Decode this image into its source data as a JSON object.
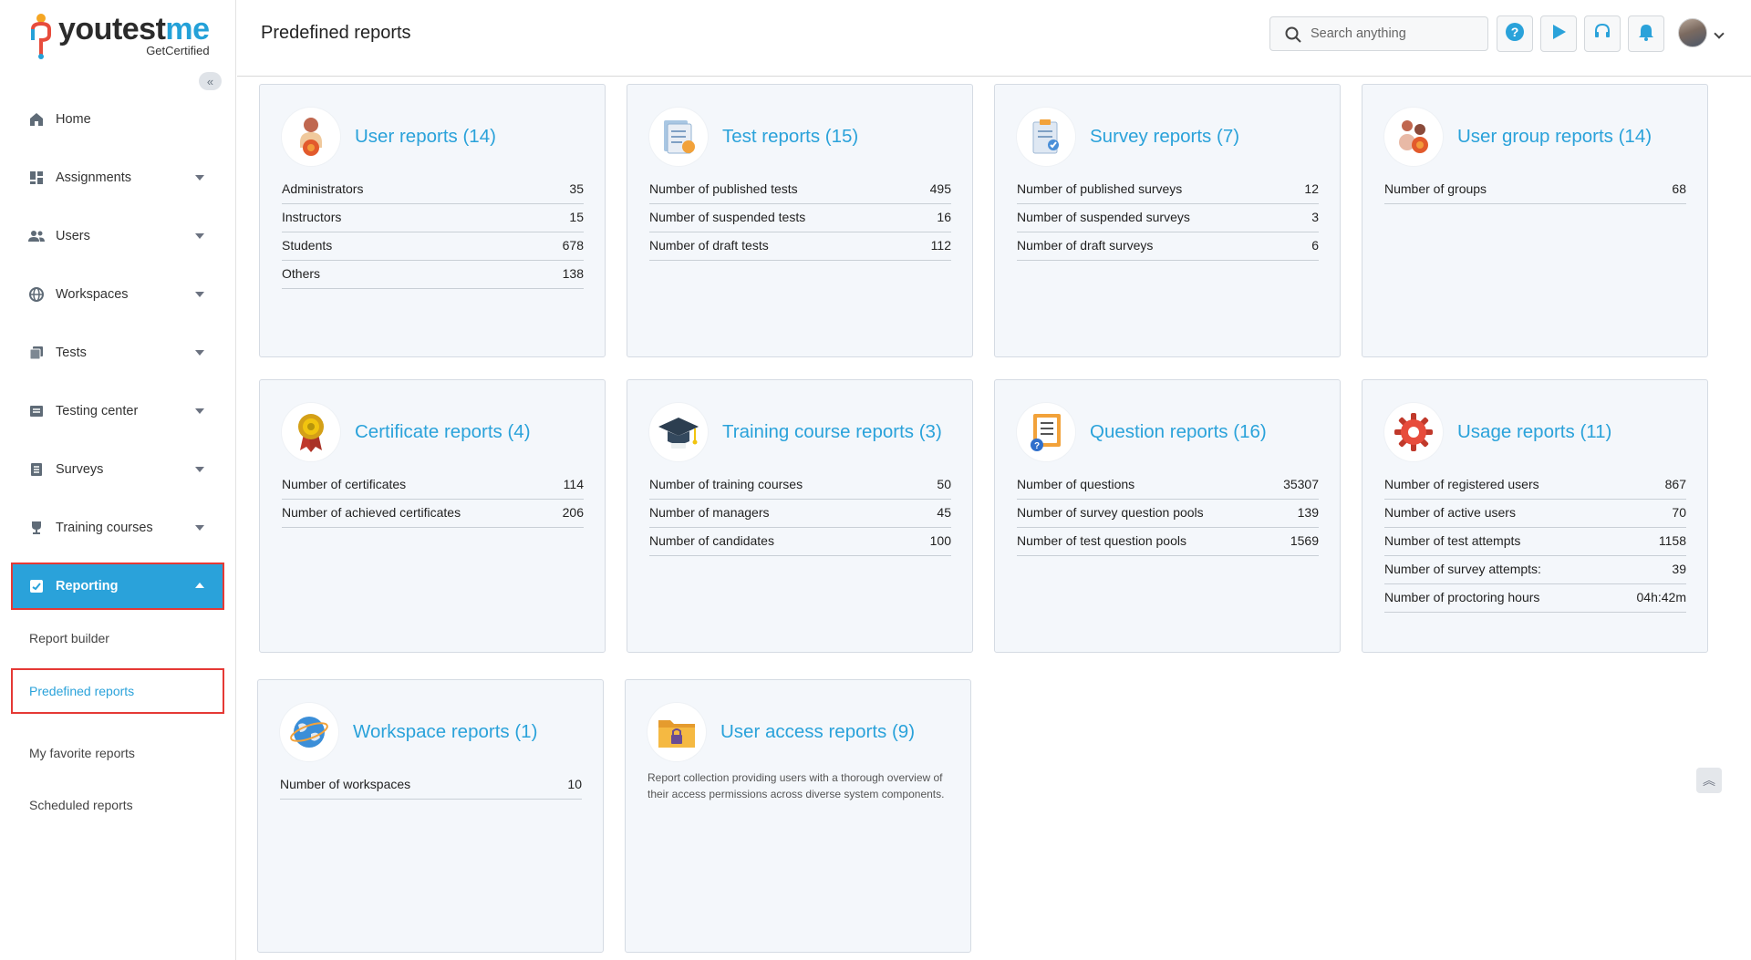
{
  "brand": {
    "name_part1": "youtest",
    "name_part2": "me",
    "tagline": "GetCertified"
  },
  "header": {
    "title": "Predefined reports",
    "search_placeholder": "Search anything"
  },
  "sidebar": {
    "items": [
      {
        "label": "Home",
        "icon": "home-icon"
      },
      {
        "label": "Assignments",
        "icon": "assignments-icon"
      },
      {
        "label": "Users",
        "icon": "users-icon"
      },
      {
        "label": "Workspaces",
        "icon": "globe-icon"
      },
      {
        "label": "Tests",
        "icon": "tests-icon"
      },
      {
        "label": "Testing center",
        "icon": "testing-center-icon"
      },
      {
        "label": "Surveys",
        "icon": "surveys-icon"
      },
      {
        "label": "Training courses",
        "icon": "trophy-icon"
      },
      {
        "label": "Reporting",
        "icon": "reporting-icon"
      }
    ],
    "reporting_sub": [
      {
        "label": "Report builder"
      },
      {
        "label": "Predefined reports"
      },
      {
        "label": "My favorite reports"
      },
      {
        "label": "Scheduled reports"
      }
    ]
  },
  "cards": [
    {
      "title": "User reports (14)",
      "icon": "user-reports-icon",
      "rows": [
        {
          "label": "Administrators",
          "value": "35"
        },
        {
          "label": "Instructors",
          "value": "15"
        },
        {
          "label": "Students",
          "value": "678"
        },
        {
          "label": "Others",
          "value": "138"
        }
      ]
    },
    {
      "title": "Test reports (15)",
      "icon": "test-reports-icon",
      "rows": [
        {
          "label": "Number of published tests",
          "value": "495"
        },
        {
          "label": "Number of suspended tests",
          "value": "16"
        },
        {
          "label": "Number of draft tests",
          "value": "112"
        }
      ]
    },
    {
      "title": "Survey reports (7)",
      "icon": "survey-reports-icon",
      "rows": [
        {
          "label": "Number of published surveys",
          "value": "12"
        },
        {
          "label": "Number of suspended surveys",
          "value": "3"
        },
        {
          "label": "Number of draft surveys",
          "value": "6"
        }
      ]
    },
    {
      "title": "User group reports (14)",
      "icon": "user-group-reports-icon",
      "rows": [
        {
          "label": "Number of groups",
          "value": "68"
        }
      ]
    },
    {
      "title": "Certificate reports (4)",
      "icon": "certificate-reports-icon",
      "rows": [
        {
          "label": "Number of certificates",
          "value": "114"
        },
        {
          "label": "Number of achieved certificates",
          "value": "206"
        }
      ]
    },
    {
      "title": "Training course reports (3)",
      "icon": "graduation-cap-icon",
      "rows": [
        {
          "label": "Number of training courses",
          "value": "50"
        },
        {
          "label": "Number of managers",
          "value": "45"
        },
        {
          "label": "Number of candidates",
          "value": "100"
        }
      ]
    },
    {
      "title": "Question reports (16)",
      "icon": "question-reports-icon",
      "rows": [
        {
          "label": "Number of questions",
          "value": "35307"
        },
        {
          "label": "Number of survey question pools",
          "value": "139"
        },
        {
          "label": "Number of test question pools",
          "value": "1569"
        }
      ]
    },
    {
      "title": "Usage reports (11)",
      "icon": "gear-icon",
      "rows": [
        {
          "label": "Number of registered users",
          "value": "867"
        },
        {
          "label": "Number of active users",
          "value": "70"
        },
        {
          "label": "Number of test attempts",
          "value": "1158"
        },
        {
          "label": "Number of survey attempts:",
          "value": "39"
        },
        {
          "label": "Number of proctoring hours",
          "value": "04h:42m"
        }
      ]
    },
    {
      "title": "Workspace reports (1)",
      "icon": "globe-icon",
      "rows": [
        {
          "label": "Number of workspaces",
          "value": "10"
        }
      ]
    },
    {
      "title": "User access reports (9)",
      "icon": "folder-lock-icon",
      "description": "Report collection providing users with a thorough overview of their access permissions across diverse system components."
    }
  ],
  "colors": {
    "accent": "#2aa2da",
    "highlight_border": "#e53935",
    "card_bg": "#f4f7fb"
  }
}
